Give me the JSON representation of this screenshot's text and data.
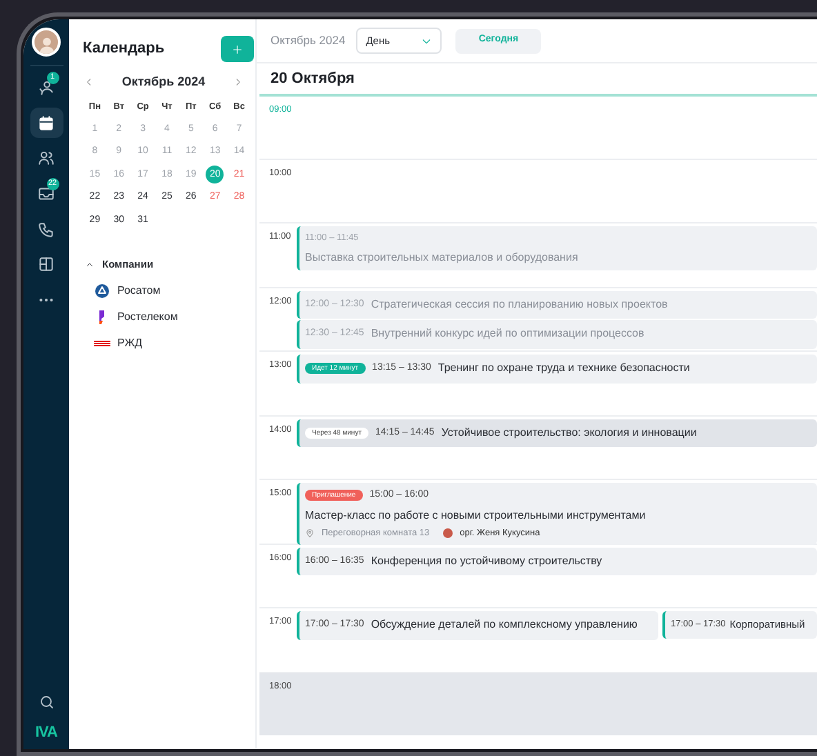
{
  "nav_rail": {
    "items": [
      {
        "kind": "activity",
        "badge": "1",
        "selected": false
      },
      {
        "kind": "calendar",
        "selected": true
      },
      {
        "kind": "contacts",
        "selected": false
      },
      {
        "kind": "mail",
        "badge": "22",
        "selected": false
      },
      {
        "kind": "phone",
        "selected": false
      },
      {
        "kind": "layout",
        "selected": false
      },
      {
        "kind": "more",
        "selected": false
      }
    ],
    "logo": "IVA"
  },
  "sidebar": {
    "title": "Календарь",
    "mini_calendar": {
      "month": "Октябрь 2024",
      "weekdays": [
        "Пн",
        "Вт",
        "Ср",
        "Чт",
        "Пт",
        "Сб",
        "Вс"
      ],
      "days": [
        {
          "label": "1",
          "past": true,
          "selected": false
        },
        {
          "label": "2",
          "past": true,
          "selected": false
        },
        {
          "label": "3",
          "past": true,
          "selected": false
        },
        {
          "label": "4",
          "past": true,
          "selected": false
        },
        {
          "label": "5",
          "past": true,
          "selected": false
        },
        {
          "label": "6",
          "past": true,
          "selected": false
        },
        {
          "label": "7",
          "past": true,
          "selected": false
        },
        {
          "label": "8",
          "past": true,
          "selected": false
        },
        {
          "label": "9",
          "past": true,
          "selected": false
        },
        {
          "label": "10",
          "past": true,
          "selected": false
        },
        {
          "label": "11",
          "past": true,
          "selected": false
        },
        {
          "label": "12",
          "past": true,
          "selected": false
        },
        {
          "label": "13",
          "past": true,
          "selected": false
        },
        {
          "label": "14",
          "past": true,
          "selected": false
        },
        {
          "label": "15",
          "past": true,
          "selected": false
        },
        {
          "label": "16",
          "past": true,
          "selected": false
        },
        {
          "label": "17",
          "past": true,
          "selected": false
        },
        {
          "label": "18",
          "past": true,
          "selected": false
        },
        {
          "label": "19",
          "past": true,
          "selected": false
        },
        {
          "label": "20",
          "selected": true
        },
        {
          "label": "21",
          "past": false,
          "weekend": true,
          "selected": false
        },
        {
          "label": "22",
          "past": false,
          "weekend": false,
          "selected": false
        },
        {
          "label": "23",
          "past": false,
          "weekend": false,
          "selected": false
        },
        {
          "label": "24",
          "past": false,
          "weekend": false,
          "selected": false
        },
        {
          "label": "25",
          "past": false,
          "weekend": false,
          "selected": false
        },
        {
          "label": "26",
          "past": false,
          "weekend": false,
          "selected": false
        },
        {
          "label": "27",
          "past": false,
          "weekend": true,
          "selected": false
        },
        {
          "label": "28",
          "past": false,
          "weekend": true,
          "selected": false
        },
        {
          "label": "29",
          "past": false,
          "weekend": false,
          "selected": false
        },
        {
          "label": "30",
          "past": false,
          "weekend": false,
          "selected": false
        },
        {
          "label": "31",
          "past": false,
          "weekend": false,
          "selected": false
        }
      ]
    },
    "companies": {
      "label": "Компании",
      "expanded": true,
      "items": [
        {
          "name": "Росатом",
          "kind": "rosatom"
        },
        {
          "name": "Ростелеком",
          "kind": "rostelecom"
        },
        {
          "name": "РЖД",
          "kind": "rzd"
        }
      ]
    }
  },
  "toolbar": {
    "period": "Октябрь 2024",
    "view": "День",
    "today": "Сегодня"
  },
  "day": {
    "title": "20 Октября",
    "slots": [
      {
        "hour": "09:00",
        "current": true,
        "off_hours": false
      },
      {
        "hour": "10:00",
        "current": false,
        "off_hours": false
      },
      {
        "hour": "11:00",
        "current": false,
        "off_hours": false,
        "parallel": false,
        "events": [
          {
            "kind": "detailed",
            "time": "11:00 – 11:45",
            "title": "Выставка строительных материалов и оборудования",
            "past": true,
            "highlighted": false
          }
        ]
      },
      {
        "hour": "12:00",
        "current": false,
        "off_hours": false,
        "parallel": false,
        "events": [
          {
            "kind": "compact",
            "time": "12:00 – 12:30",
            "title": "Стратегическая сессия по планированию новых проектов",
            "past": true,
            "highlighted": false
          },
          {
            "kind": "compact",
            "time": "12:30 – 12:45",
            "title": "Внутренний конкурс идей по оптимизации процессов",
            "past": true,
            "highlighted": false
          }
        ]
      },
      {
        "hour": "13:00",
        "current": false,
        "off_hours": false,
        "parallel": false,
        "events": [
          {
            "kind": "compact",
            "badge": {
              "text": "Идет 12 минут",
              "kind": "ongoing"
            },
            "time": "13:15 – 13:30",
            "title": "Тренинг по охране труда и технике безопасности",
            "past": false,
            "highlighted": false
          }
        ]
      },
      {
        "hour": "14:00",
        "current": false,
        "off_hours": false,
        "parallel": false,
        "events": [
          {
            "kind": "compact",
            "badge": {
              "text": "Через 48 минут",
              "kind": "soon"
            },
            "time": "14:15 – 14:45",
            "title": "Устойчивое строительство: экология и инновации",
            "past": false,
            "highlighted": true
          }
        ]
      },
      {
        "hour": "15:00",
        "current": false,
        "off_hours": false,
        "parallel": false,
        "events": [
          {
            "kind": "detailed",
            "badge": {
              "text": "Приглашение",
              "kind": "invite"
            },
            "time": "15:00 – 16:00",
            "title": "Мастер-класс по работе с новыми строительными инструментами",
            "location": "Переговорная комната 13",
            "organizer": "орг. Женя Кукусина",
            "past": false,
            "highlighted": false
          }
        ]
      },
      {
        "hour": "16:00",
        "current": false,
        "off_hours": false,
        "parallel": false,
        "events": [
          {
            "kind": "compact",
            "time": "16:00 – 16:35",
            "title": "Конференция по устойчивому строительству",
            "past": false,
            "highlighted": false
          }
        ]
      },
      {
        "hour": "17:00",
        "current": false,
        "off_hours": false,
        "parallel": true,
        "events": [
          {
            "kind": "compact",
            "time": "17:00 – 17:30",
            "title": "Обсуждение деталей по комплексному управлению",
            "past": false,
            "highlighted": false
          },
          {
            "kind": "compact",
            "time": "17:00 – 17:30",
            "title": "Корпоративный",
            "past": false,
            "highlighted": false
          }
        ]
      },
      {
        "hour": "18:00",
        "current": false,
        "off_hours": true
      }
    ]
  }
}
